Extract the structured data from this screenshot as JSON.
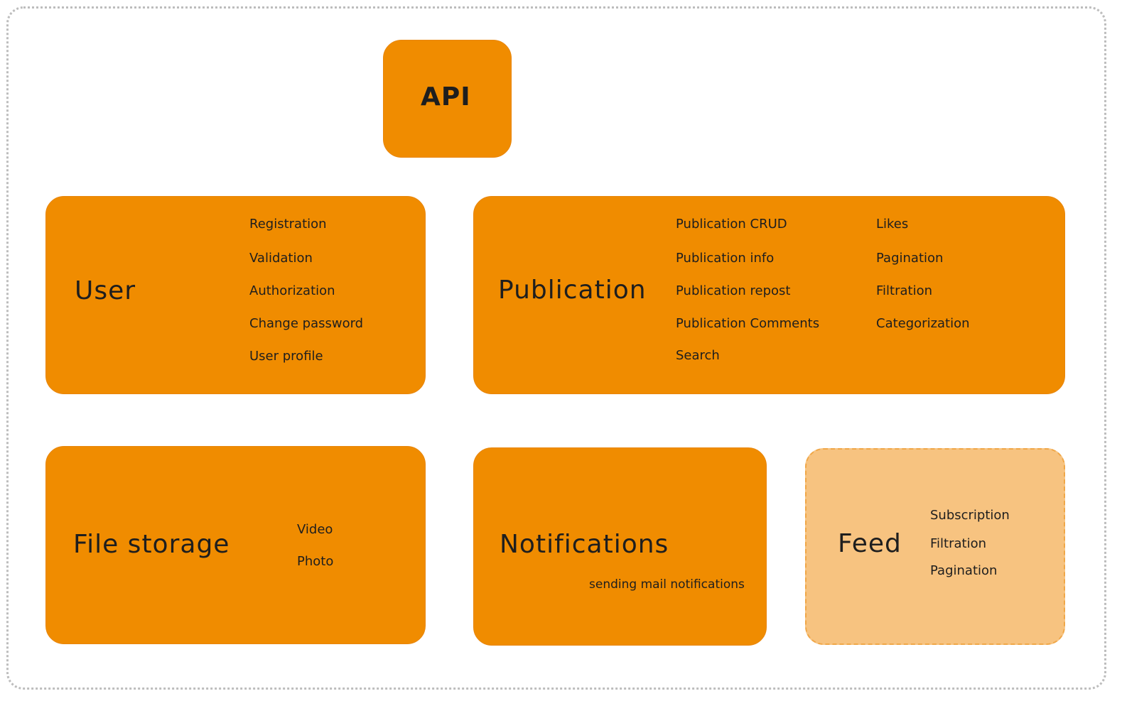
{
  "api": {
    "title": "API"
  },
  "user": {
    "title": "User",
    "items": [
      "Registration",
      "Validation",
      "Authorization",
      "Change password",
      "User profile"
    ]
  },
  "publication": {
    "title": "Publication",
    "items_left": [
      "Publication CRUD",
      "Publication info",
      "Publication repost",
      "Publication Comments",
      "Search"
    ],
    "items_right": [
      "Likes",
      "Pagination",
      "Filtration",
      "Categorization"
    ]
  },
  "file_storage": {
    "title": "File storage",
    "items": [
      "Video",
      "Photo"
    ]
  },
  "notifications": {
    "title": "Notifications",
    "note": "sending mail notifications"
  },
  "feed": {
    "title": "Feed",
    "items": [
      "Subscription",
      "Filtration",
      "Pagination"
    ]
  },
  "colors": {
    "module_fill": "#f08c00",
    "planned_fill": "#f7c380",
    "frame_border": "#bdbdbd",
    "text": "#1e1e1e"
  }
}
